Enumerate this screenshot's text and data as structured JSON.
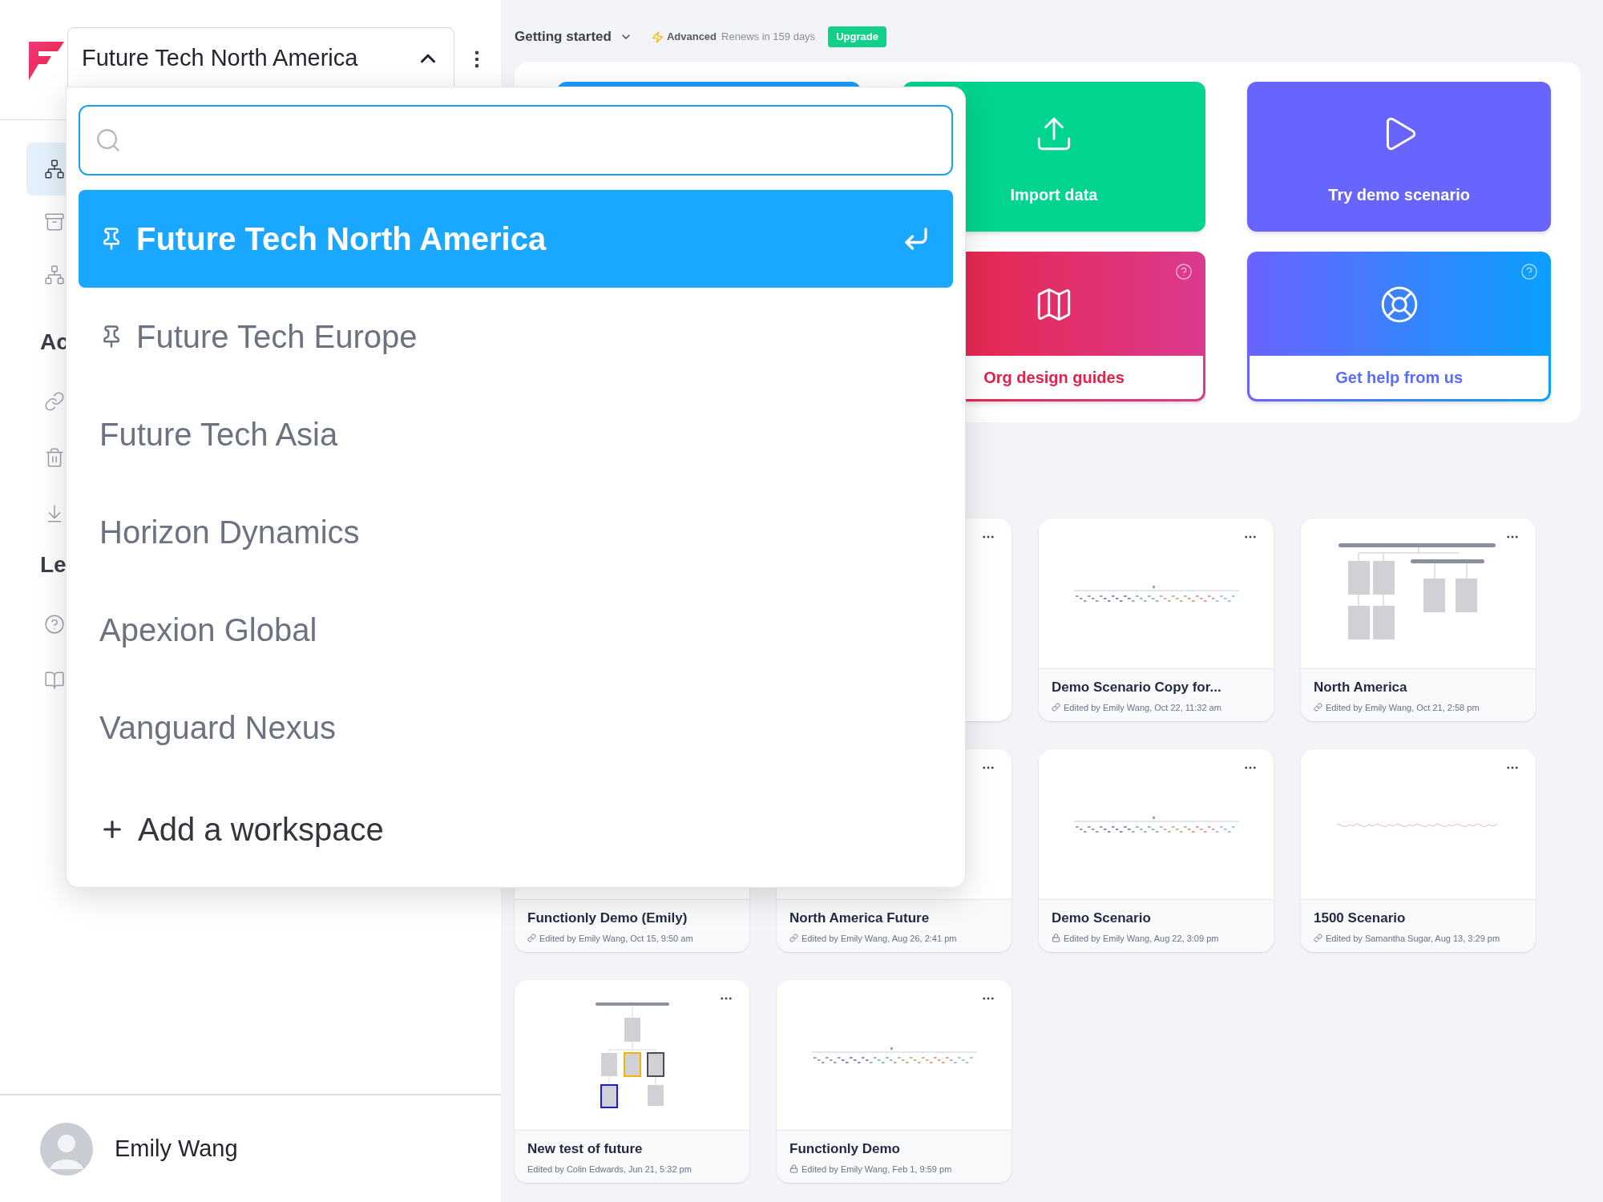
{
  "workspace_switcher": {
    "label": "Future Tech North America",
    "expanded": true
  },
  "sidebar": {
    "nav": [
      {
        "selected": true
      },
      {
        "selected": false
      },
      {
        "selected": false
      }
    ],
    "sections": [
      {
        "heading": "Ac"
      },
      {
        "heading": "Le"
      }
    ]
  },
  "user": {
    "name": "Emily Wang"
  },
  "topbar": {
    "title": "Getting started",
    "plan": "Advanced",
    "renewal": "Renews in 159 days",
    "upgrade": "Upgrade"
  },
  "action_cards": [
    {
      "kind": "blank"
    },
    {
      "kind": "import",
      "label": "Import data"
    },
    {
      "kind": "demo",
      "label": "Try demo scenario"
    },
    {
      "kind": "guides",
      "label": "Org design guides",
      "help": true
    },
    {
      "kind": "help",
      "label": "Get help from us",
      "help": true
    }
  ],
  "documents": [
    {
      "menu": true
    },
    {
      "title": "Demo Scenario Copy for...",
      "meta": "Edited by Emily Wang, Oct 22, 11:32 am",
      "linked": true,
      "locked": false,
      "kind": "wide",
      "menu": true
    },
    {
      "title": "North America",
      "meta": "Edited by Emily Wang, Oct 21, 2:58 pm",
      "linked": true,
      "locked": false,
      "kind": "simple",
      "menu": true
    },
    {
      "title": "Functionly Demo (Emily)",
      "meta": "Edited by Emily Wang, Oct 15, 9:50 am",
      "linked": true,
      "locked": false,
      "menu": false
    },
    {
      "title": "North America Future",
      "meta": "Edited by Emily Wang, Aug 26, 2:41 pm",
      "linked": true,
      "locked": false,
      "menu": true
    },
    {
      "title": "Demo Scenario",
      "meta": "Edited by Emily Wang, Aug 22, 3:09 pm",
      "linked": false,
      "locked": true,
      "kind": "wide",
      "menu": true
    },
    {
      "title": "1500 Scenario",
      "meta": "Edited by Samantha Sugar, Aug 13, 3:29 pm",
      "linked": true,
      "locked": false,
      "kind": "faint",
      "menu": true
    },
    {
      "title": "New test of future",
      "meta": "Edited by Colin Edwards, Jun 21, 5:32 pm",
      "linked": false,
      "locked": false,
      "kind": "tree",
      "menu": true
    },
    {
      "title": "Functionly Demo",
      "meta": "Edited by Emily Wang, Feb 1, 9:59 pm",
      "linked": false,
      "locked": true,
      "kind": "wide",
      "menu": true
    }
  ],
  "dropdown": {
    "workspaces": [
      {
        "name": "Future Tech North America",
        "pinned": true,
        "selected": true
      },
      {
        "name": "Future Tech Europe",
        "pinned": true,
        "selected": false
      },
      {
        "name": "Future Tech Asia",
        "pinned": false,
        "selected": false
      },
      {
        "name": "Horizon Dynamics",
        "pinned": false,
        "selected": false
      },
      {
        "name": "Apexion Global",
        "pinned": false,
        "selected": false
      },
      {
        "name": "Vanguard Nexus",
        "pinned": false,
        "selected": false
      }
    ],
    "add_label": "Add a workspace"
  }
}
